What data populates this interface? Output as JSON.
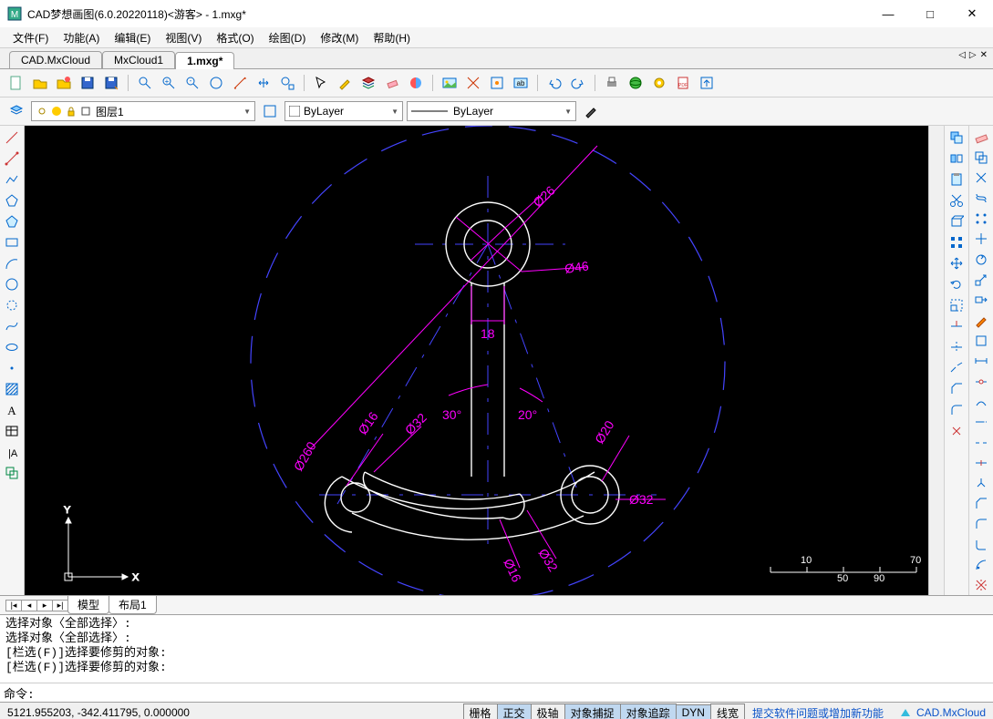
{
  "title": "CAD梦想画图(6.0.20220118)<游客> - 1.mxg*",
  "menu": [
    "文件(F)",
    "功能(A)",
    "编辑(E)",
    "视图(V)",
    "格式(O)",
    "绘图(D)",
    "修改(M)",
    "帮助(H)"
  ],
  "doc_tabs": [
    "CAD.MxCloud",
    "MxCloud1",
    "1.mxg*"
  ],
  "active_doc_tab": 2,
  "layer": {
    "current": "图层1"
  },
  "color": {
    "current": "ByLayer"
  },
  "linetype": {
    "current": "ByLayer"
  },
  "layout_tabs": [
    "模型",
    "布局1"
  ],
  "active_layout_tab": 0,
  "cmdlog": [
    "选择对象〈全部选择〉:",
    "选择对象〈全部选择〉:",
    "[栏选(F)]选择要修剪的对象:",
    "[栏选(F)]选择要修剪的对象:"
  ],
  "cmd_prompt": "命令:",
  "status": {
    "coords": "5121.955203, -342.411795,  0.000000",
    "toggles": [
      "栅格",
      "正交",
      "极轴",
      "对象捕捉",
      "对象追踪",
      "DYN",
      "线宽"
    ],
    "active_toggles": [
      1,
      3,
      4,
      5
    ],
    "link": "提交软件问题或增加新功能",
    "brand": "CAD.MxCloud"
  },
  "drawing": {
    "dimensions": {
      "d26": "Ø26",
      "d46": "Ø46",
      "w18": "18",
      "a30": "30°",
      "a20": "20°",
      "d16a": "Ø16",
      "d32a": "Ø32",
      "d20": "Ø20",
      "d32b": "Ø32",
      "d16b": "Ø16",
      "d32c": "Ø32",
      "d260": "Ø260"
    },
    "ruler": {
      "t10": "10",
      "t50": "50",
      "t70": "70",
      "t90": "90"
    }
  }
}
